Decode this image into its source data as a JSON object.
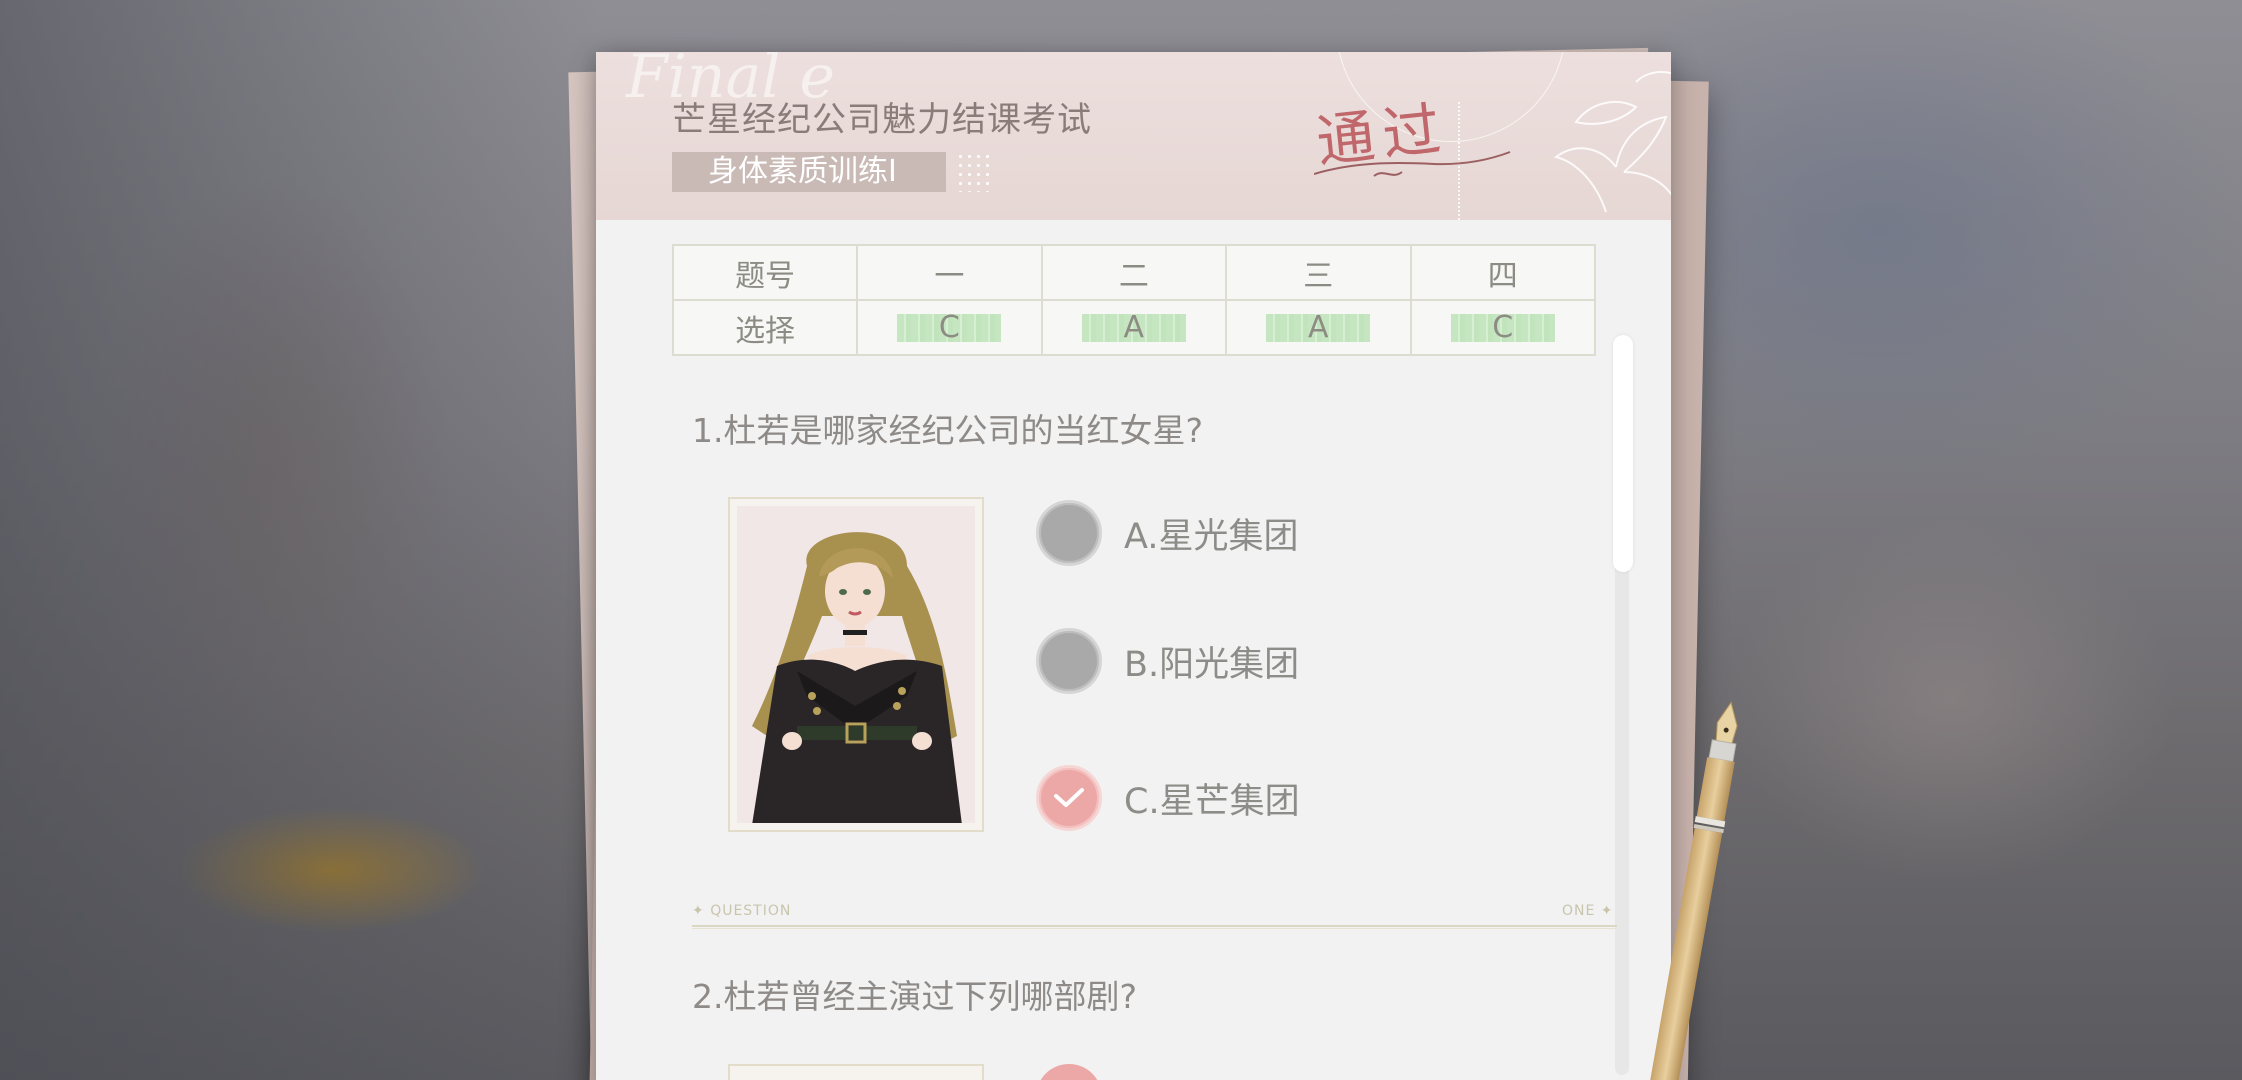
{
  "exam": {
    "title": "芒星经纪公司魅力结课考试",
    "section": "身体素质训练I",
    "stamp": "通过",
    "script_deco": "Final e"
  },
  "answer_table": {
    "row_headers": [
      "题号",
      "选择"
    ],
    "question_numbers": [
      "一",
      "二",
      "三",
      "四"
    ],
    "answers": [
      "C",
      "A",
      "A",
      "C"
    ],
    "answer_highlight_color": "#c6e6c1"
  },
  "questions": [
    {
      "text": "1.杜若是哪家经纪公司的当红女星?",
      "options": [
        {
          "label": "A.星光集团",
          "selected": false
        },
        {
          "label": "B.阳光集团",
          "selected": false
        },
        {
          "label": "C.星芒集团",
          "selected": true
        }
      ]
    },
    {
      "text": "2.杜若曾经主演过下列哪部剧?"
    }
  ],
  "divider": {
    "left_label": "QUESTION",
    "right_label": "ONE"
  },
  "colors": {
    "selected_option": "#eba8a7",
    "unselected_option": "#a9a9a9",
    "stamp": "#c0676c",
    "header_bg": "#ecdfdd"
  }
}
